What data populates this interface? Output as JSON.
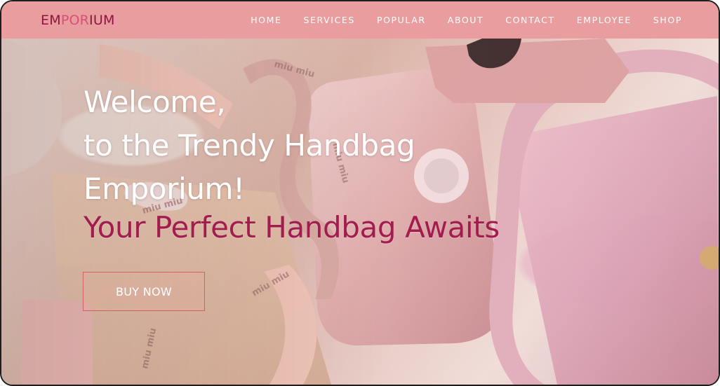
{
  "brand": {
    "logo_part_1": "EM",
    "logo_part_2": "POR",
    "logo_part_3": "IUM"
  },
  "nav": {
    "items": [
      {
        "label": "HOME"
      },
      {
        "label": "SERVICES"
      },
      {
        "label": "POPULAR"
      },
      {
        "label": "ABOUT"
      },
      {
        "label": "CONTACT"
      },
      {
        "label": "EMPLOYEE"
      },
      {
        "label": "SHOP"
      }
    ]
  },
  "hero": {
    "line_1": "Welcome,",
    "line_2": "to the Trendy Handbag",
    "line_3": "Emporium!",
    "tagline": "Your Perfect Handbag Awaits",
    "cta_label": "BUY NOW",
    "image_label": "miu miu"
  },
  "colors": {
    "nav_background": "#e99d9f",
    "logo_dark": "#8c163d",
    "logo_accent": "#d84f77",
    "tagline": "#a21c4d",
    "button_border": "#d65f5f",
    "hero_tone": "#e8c8bf"
  }
}
